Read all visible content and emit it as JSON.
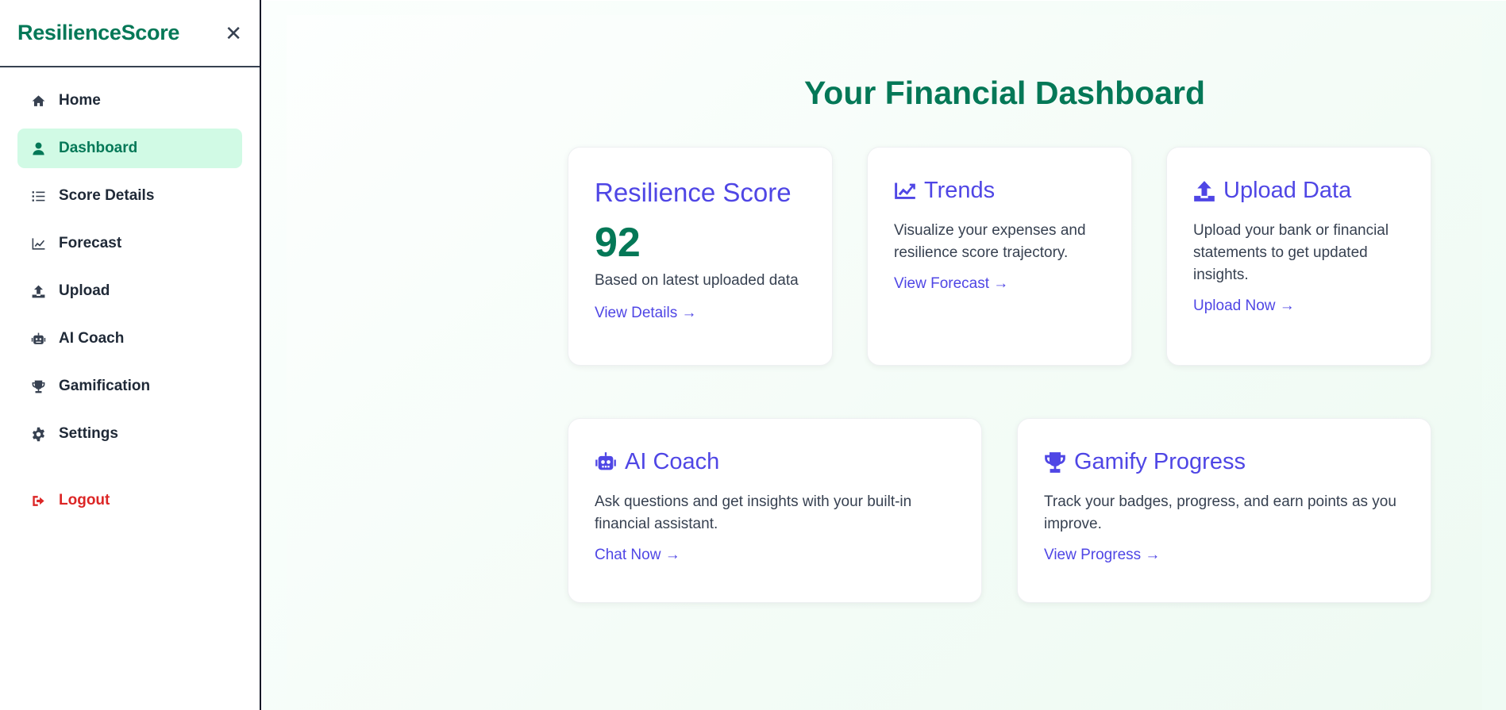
{
  "sidebar": {
    "brand": "ResilienceScore",
    "close_label": "✕",
    "items": [
      {
        "label": "Home",
        "icon": "home-icon",
        "active": false
      },
      {
        "label": "Dashboard",
        "icon": "user-icon",
        "active": true
      },
      {
        "label": "Score Details",
        "icon": "list-icon",
        "active": false
      },
      {
        "label": "Forecast",
        "icon": "line-chart-icon",
        "active": false
      },
      {
        "label": "Upload",
        "icon": "upload-icon",
        "active": false
      },
      {
        "label": "AI Coach",
        "icon": "robot-icon",
        "active": false
      },
      {
        "label": "Gamification",
        "icon": "trophy-icon",
        "active": false
      },
      {
        "label": "Settings",
        "icon": "gear-icon",
        "active": false
      }
    ],
    "logout_label": "Logout"
  },
  "main": {
    "title": "Your Financial Dashboard",
    "cards": {
      "score": {
        "title": "Resilience Score",
        "value": "92",
        "desc": "Based on latest uploaded data",
        "link": "View Details →"
      },
      "trends": {
        "title": "Trends",
        "desc": "Visualize your expenses and resilience score trajectory.",
        "link": "View Forecast →"
      },
      "upload": {
        "title": "Upload Data",
        "desc": "Upload your bank or financial statements to get updated insights.",
        "link": "Upload Now →"
      },
      "coach": {
        "title": "AI Coach",
        "desc": "Ask questions and get insights with your built-in financial assistant.",
        "link": "Chat Now →"
      },
      "gamify": {
        "title": "Gamify Progress",
        "desc": "Track your badges, progress, and earn points as you improve.",
        "link": "View Progress →"
      }
    }
  },
  "colors": {
    "brand_green": "#047857",
    "accent_indigo": "#4f46e5",
    "active_bg": "#d1fae5",
    "logout_red": "#dc2626"
  }
}
